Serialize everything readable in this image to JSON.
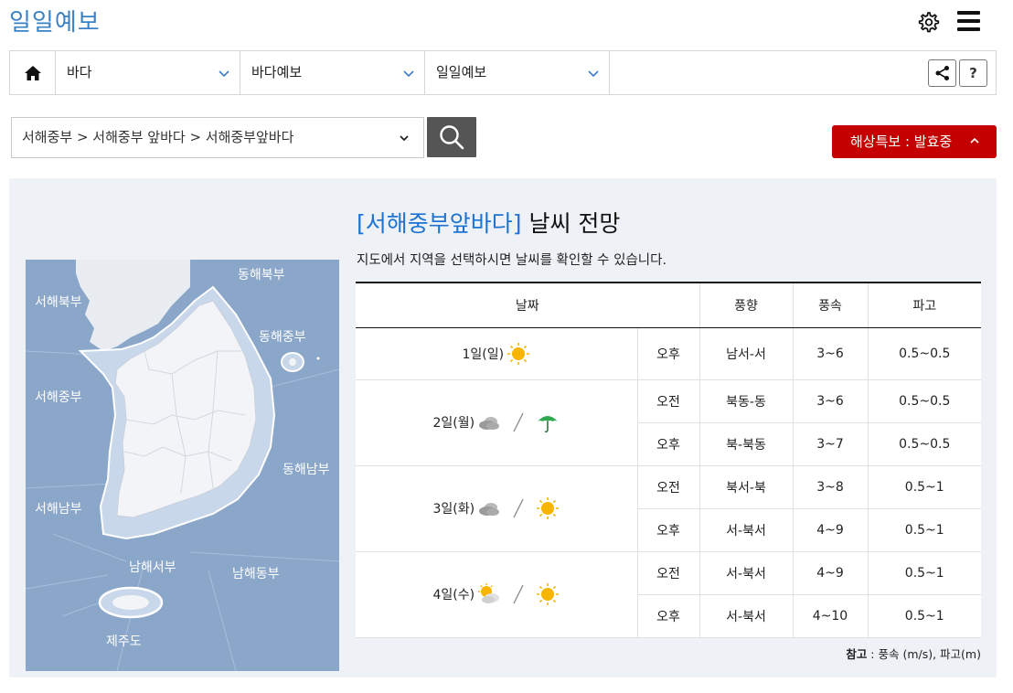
{
  "header": {
    "title": "일일예보",
    "icons": [
      "gear-icon",
      "menu-icon"
    ]
  },
  "nav": {
    "home_icon": "home-icon",
    "selects": [
      "바다",
      "바다예보",
      "일일예보"
    ],
    "share_icon": "share-icon",
    "help_label": "?"
  },
  "search": {
    "value": "서해중부 > 서해중부 앞바다 > 서해중부앞바다",
    "search_icon": "search-icon"
  },
  "warning": {
    "label": "해상특보 : 발효중",
    "color": "#c40000"
  },
  "map": {
    "labels": [
      "동해북부",
      "서해북부",
      "동해중부",
      "서해중부",
      "동해남부",
      "서해남부",
      "남해서부",
      "남해동부",
      "제주도"
    ]
  },
  "forecast": {
    "title_location": "[서해중부앞바다]",
    "title_rest": " 날씨 전망",
    "description": "지도에서 지역을 선택하시면 날씨를 확인할 수 있습니다.",
    "headers": [
      "날짜",
      "풍향",
      "풍속",
      "파고"
    ],
    "days": [
      {
        "date": "1일(일)",
        "icons": [
          "sun-icon"
        ],
        "rows": [
          {
            "period": "오후",
            "direction": "남서-서",
            "speed": "3~6",
            "wave": "0.5~0.5"
          }
        ]
      },
      {
        "date": "2일(월)",
        "icons": [
          "cloudy-icon",
          "umbrella-icon"
        ],
        "rows": [
          {
            "period": "오전",
            "direction": "북동-동",
            "speed": "3~6",
            "wave": "0.5~0.5"
          },
          {
            "period": "오후",
            "direction": "북-북동",
            "speed": "3~7",
            "wave": "0.5~0.5"
          }
        ]
      },
      {
        "date": "3일(화)",
        "icons": [
          "cloudy-icon",
          "sun-icon"
        ],
        "rows": [
          {
            "period": "오전",
            "direction": "북서-북",
            "speed": "3~8",
            "wave": "0.5~1"
          },
          {
            "period": "오후",
            "direction": "서-북서",
            "speed": "4~9",
            "wave": "0.5~1"
          }
        ]
      },
      {
        "date": "4일(수)",
        "icons": [
          "partly-cloudy-icon",
          "sun-icon"
        ],
        "rows": [
          {
            "period": "오전",
            "direction": "서-북서",
            "speed": "4~9",
            "wave": "0.5~1"
          },
          {
            "period": "오후",
            "direction": "서-북서",
            "speed": "4~10",
            "wave": "0.5~1"
          }
        ]
      }
    ],
    "note_label": "참고",
    "note_text": " : 풍속 (m/s), 파고(m)"
  }
}
